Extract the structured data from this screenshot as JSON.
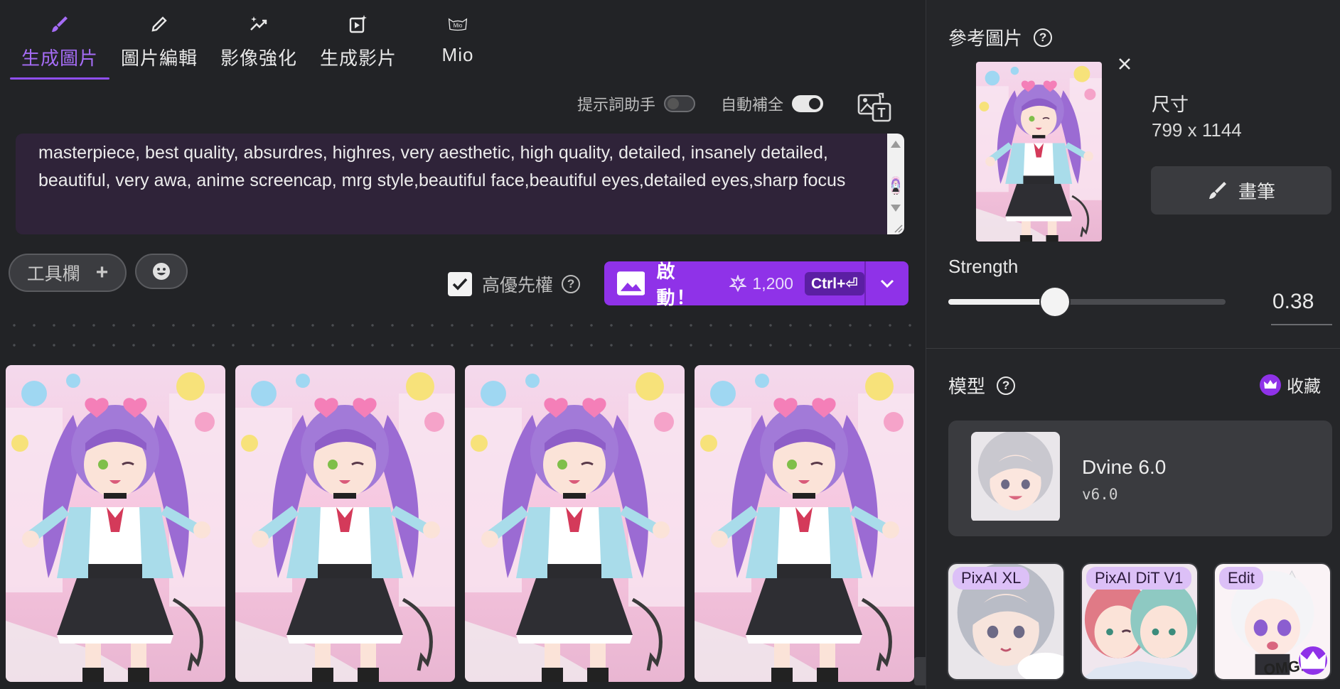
{
  "tabs": [
    {
      "label": "生成圖片",
      "icon": "brush-icon",
      "active": true
    },
    {
      "label": "圖片編輯",
      "icon": "pencil-icon",
      "active": false
    },
    {
      "label": "影像強化",
      "icon": "sparkle-trend-icon",
      "active": false
    },
    {
      "label": "生成影片",
      "icon": "video-spark-icon",
      "active": false
    },
    {
      "label": "Mio",
      "icon": "mio-cat-icon",
      "active": false
    }
  ],
  "toggles": {
    "prompt_helper": {
      "label": "提示詞助手",
      "on": false
    },
    "autocomplete": {
      "label": "自動補全",
      "on": true
    }
  },
  "prompt": {
    "text": "masterpiece, best quality, absurdres, highres, very aesthetic, high quality, detailed, insanely detailed, beautiful, very awa, anime screencap, mrg style,beautiful face,beautiful eyes,detailed eyes,sharp focus"
  },
  "toolbar": {
    "tools_label": "工具欄",
    "tools_plus": "+",
    "priority_label": "高優先權",
    "priority_checked": true
  },
  "launch": {
    "label": "啟動！",
    "cost": "1,200",
    "shortcut": "Ctrl+⏎"
  },
  "right": {
    "ref_title": "參考圖片",
    "size_label": "尺寸",
    "size_value": "799 x 1144",
    "brush_label": "畫筆",
    "strength_label": "Strength",
    "strength_value": "0.38",
    "model_title": "模型",
    "favorites_label": "收藏",
    "model": {
      "name": "Dvine 6.0",
      "version": "v6.0"
    },
    "mini_models": [
      {
        "tag": "PixAI XL"
      },
      {
        "tag": "PixAI DiT V1"
      },
      {
        "tag": "Edit"
      }
    ]
  },
  "colors": {
    "accent": "#8f32e8",
    "accent_text": "#a56cf5",
    "background": "#222326",
    "prompt_bg": "#2f2339"
  }
}
